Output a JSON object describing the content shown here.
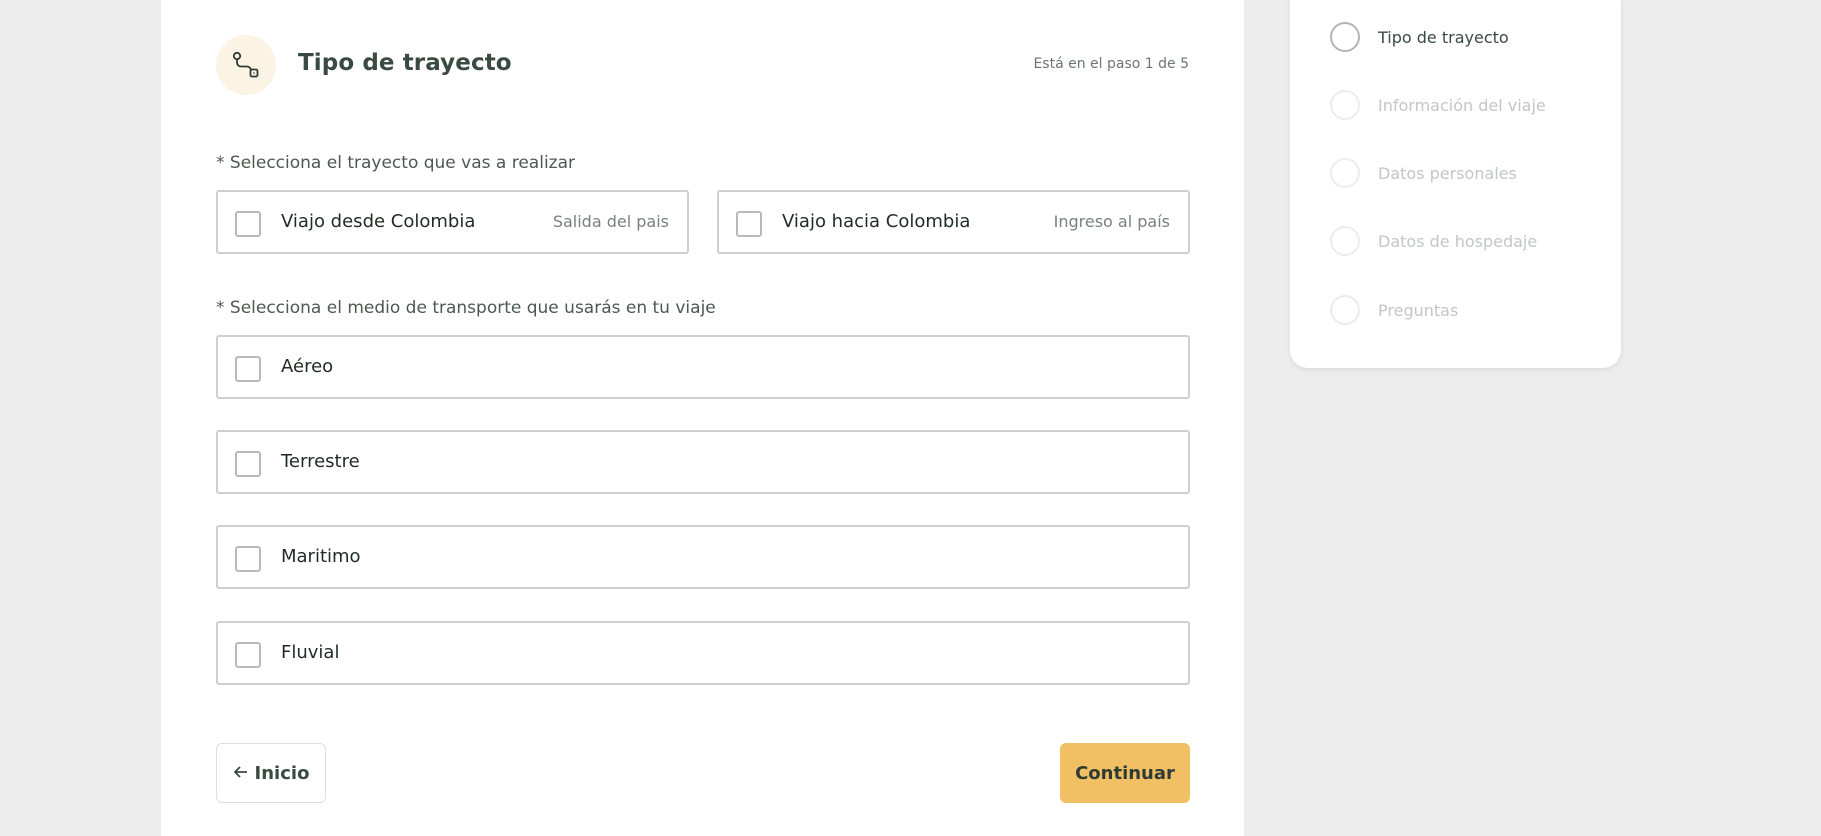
{
  "header": {
    "title": "Tipo de trayecto",
    "step_indicator": "Está en el paso 1 de 5",
    "icon": "route-icon"
  },
  "route_section": {
    "label": "* Selecciona el trayecto que vas a realizar",
    "options": [
      {
        "label": "Viajo desde Colombia",
        "hint": "Salida del pais",
        "checked": false
      },
      {
        "label": "Viajo hacia Colombia",
        "hint": "Ingreso al país",
        "checked": false
      }
    ]
  },
  "transport_section": {
    "label": "* Selecciona el medio de transporte que usarás en tu viaje",
    "options": [
      {
        "label": "Aéreo",
        "checked": false
      },
      {
        "label": "Terrestre",
        "checked": false
      },
      {
        "label": "Maritimo",
        "checked": false
      },
      {
        "label": "Fluvial",
        "checked": false
      }
    ]
  },
  "actions": {
    "back_label": "Inicio",
    "continue_label": "Continuar"
  },
  "steps": [
    {
      "label": "Tipo de trayecto",
      "active": true
    },
    {
      "label": "Información del viaje",
      "active": false
    },
    {
      "label": "Datos personales",
      "active": false
    },
    {
      "label": "Datos de hospedaje",
      "active": false
    },
    {
      "label": "Preguntas",
      "active": false
    }
  ],
  "colors": {
    "accent": "#f2c064",
    "icon_bg": "#fbf3e4",
    "page_bg": "#ededee"
  }
}
